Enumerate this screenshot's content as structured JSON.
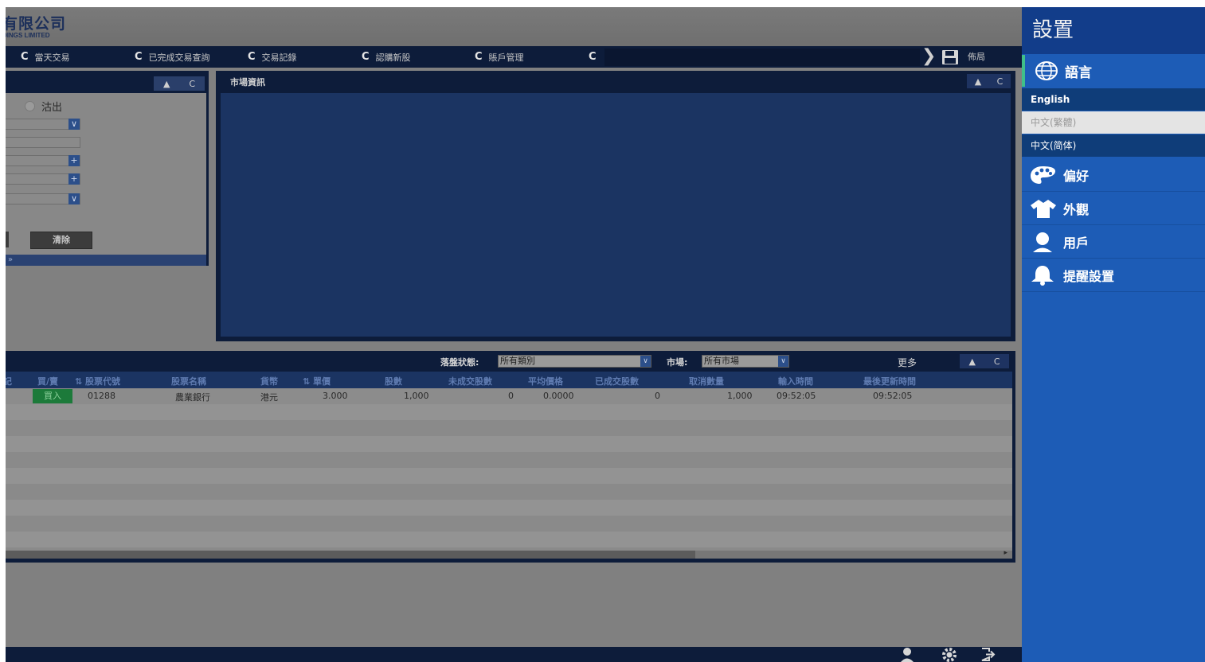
{
  "brand": {
    "name_cn": "有限公司",
    "name_en": "DINGS LIMITED"
  },
  "tabs": [
    {
      "label": "當天交易"
    },
    {
      "label": "已完成交易查詢"
    },
    {
      "label": "交易記錄"
    },
    {
      "label": "認購新股"
    },
    {
      "label": "賬戶管理"
    },
    {
      "label": ""
    }
  ],
  "tab_layout_label": "佈局",
  "order_panel": {
    "radio_label": "沽出",
    "clear_label": "清除",
    "footer_glyph": "»"
  },
  "market_panel": {
    "title": "市場資訊"
  },
  "orders_panel": {
    "status_label": "落盤狀態:",
    "status_value": "所有類別",
    "market_label": "市場:",
    "market_value": "所有市場",
    "more_label": "更多",
    "columns": [
      "記",
      "買/賣",
      "⇅ 股票代號",
      "股票名稱",
      "貨幣",
      "⇅ 單價",
      "股數",
      "未成交股數",
      "平均價格",
      "已成交股數",
      "取消數量",
      "輸入時間",
      "最後更新時間"
    ],
    "rows": [
      {
        "side": "買入",
        "code": "01288",
        "name": "農業銀行",
        "currency": "港元",
        "price": "3.000",
        "qty": "1,000",
        "unfilled": "0",
        "avg_price": "0.0000",
        "filled": "0",
        "cancel_qty": "1,000",
        "input_time": "09:52:05",
        "update_time": "09:52:05"
      }
    ]
  },
  "panel_controls": {
    "collapse": "▲",
    "refresh": "C"
  },
  "settings": {
    "title": "設置",
    "language_header": "語言",
    "languages": [
      {
        "label": "English"
      },
      {
        "label": "中文(繁體)"
      },
      {
        "label": "中文(简体)"
      }
    ],
    "items": [
      {
        "label": "偏好",
        "icon": "palette-icon"
      },
      {
        "label": "外觀",
        "icon": "shirt-icon"
      },
      {
        "label": "用戶",
        "icon": "user-icon"
      },
      {
        "label": "提醒設置",
        "icon": "bell-icon"
      }
    ]
  },
  "colors": {
    "navy": "#0d1c3a",
    "drawer_blue": "#1d5cb6",
    "drawer_title": "#123d8a",
    "active_accent": "#3fc08a",
    "buy_green": "#1c7a3a"
  }
}
